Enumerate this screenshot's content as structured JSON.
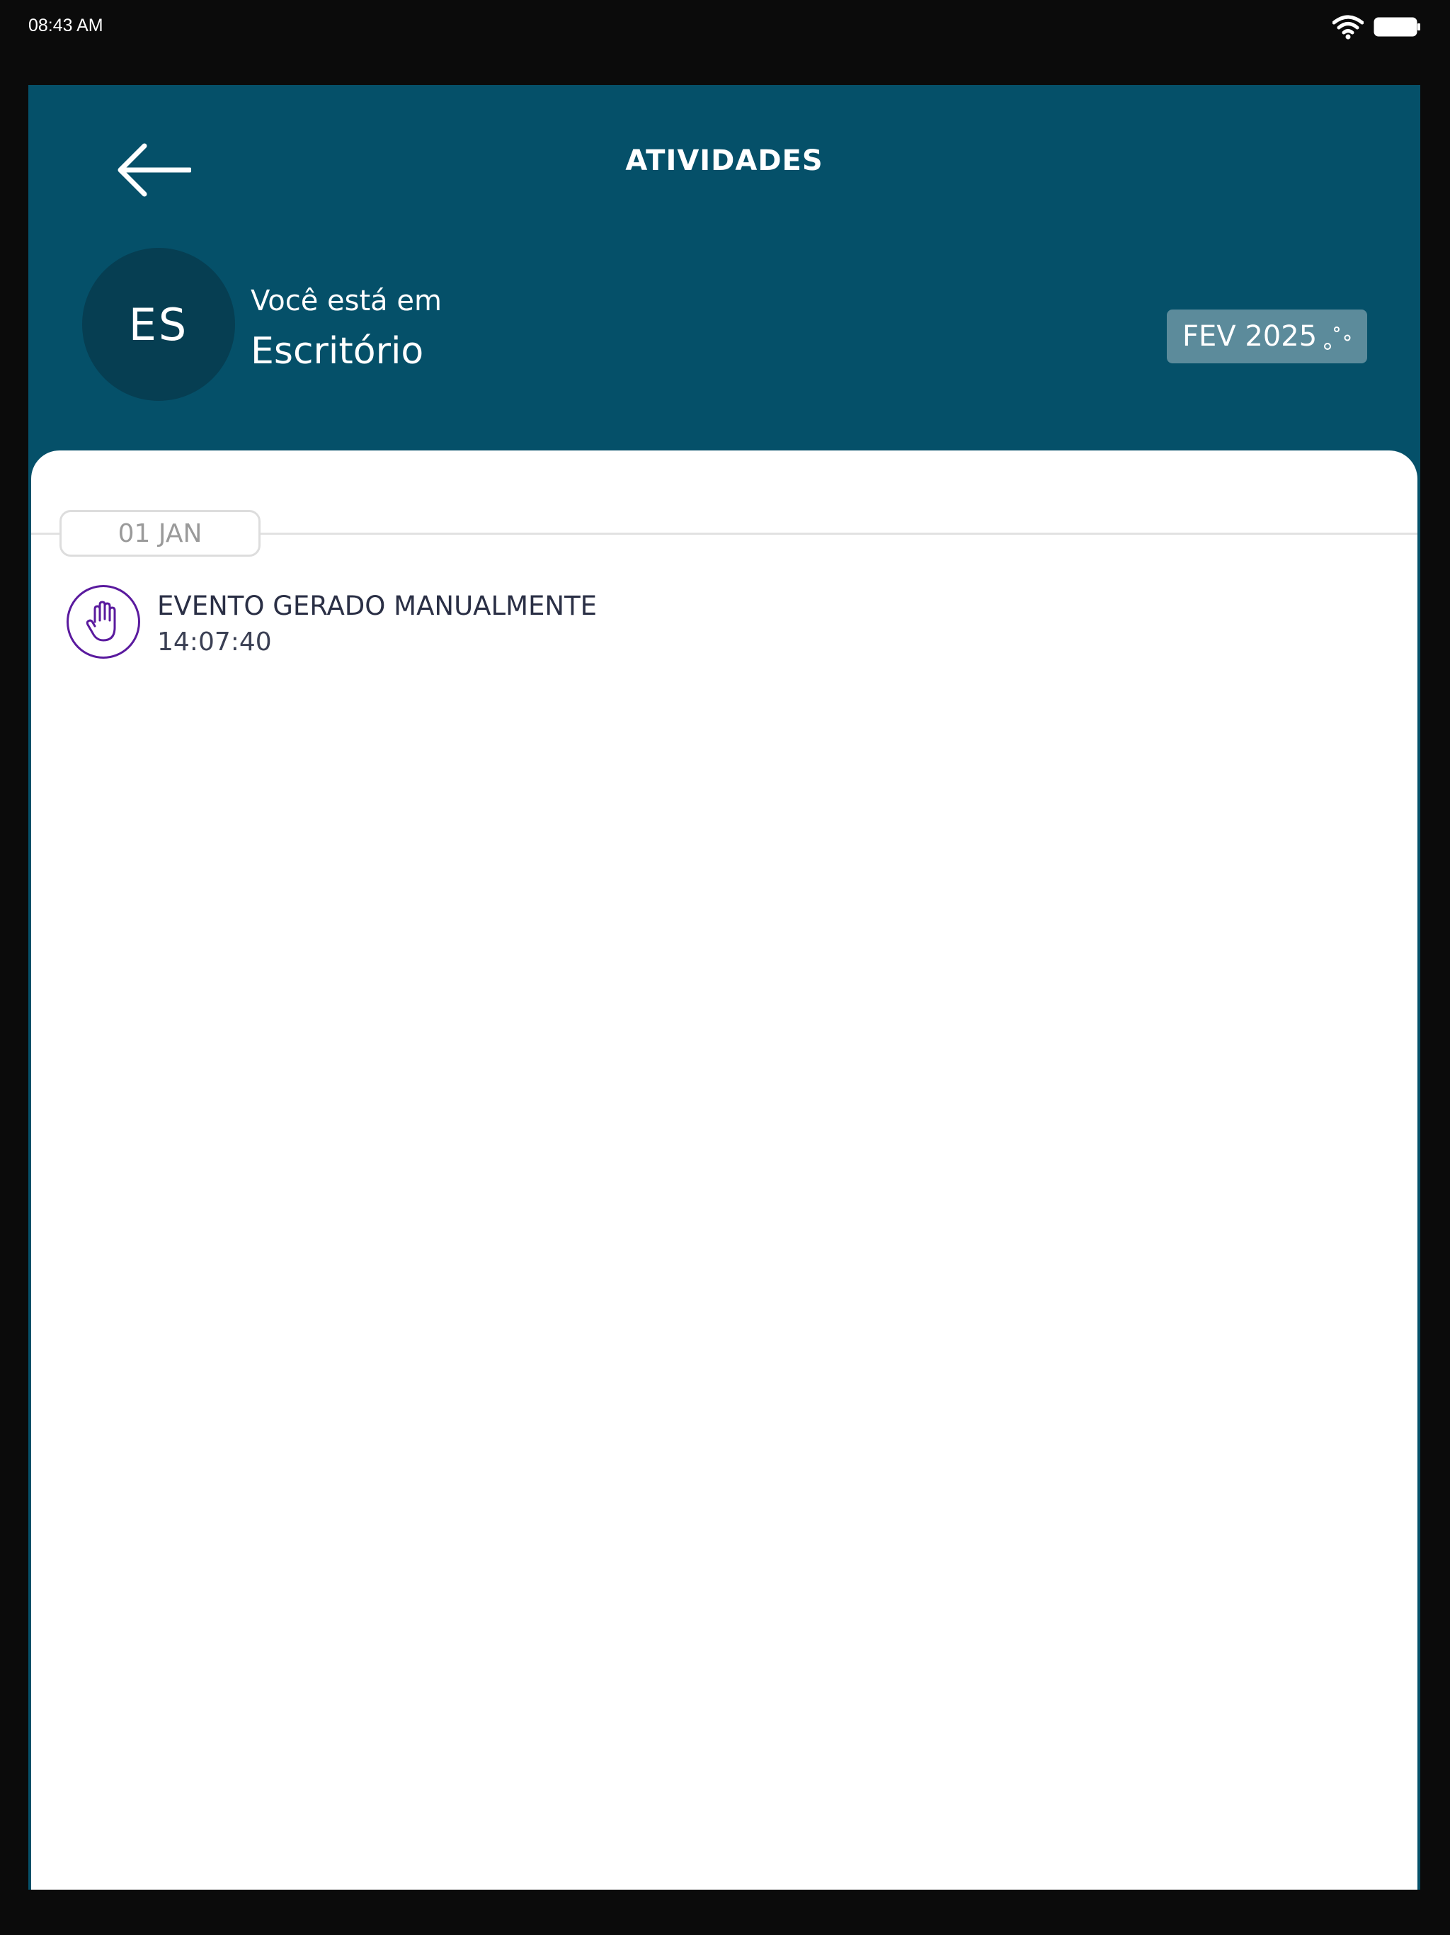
{
  "status_bar": {
    "time": "08:43 AM",
    "icons": [
      "wifi-icon",
      "battery-icon"
    ]
  },
  "header": {
    "title": "ATIVIDADES",
    "back_icon": "arrow-left-icon"
  },
  "location": {
    "avatar_initials": "ES",
    "label": "Você está em",
    "name": "Escritório"
  },
  "month_selector": {
    "value": "FEV 2025",
    "icon": "loading-dots-icon"
  },
  "activities": {
    "date_label": "01 JAN",
    "events": [
      {
        "title": "EVENTO GERADO MANUALMENTE",
        "time": "14:07:40",
        "icon": "hand-icon"
      }
    ]
  },
  "colors": {
    "header_bg": "#055069",
    "avatar_bg": "#063e52",
    "month_chip_bg": "#5c8b9b",
    "event_icon_accent": "#5a1a9e"
  }
}
